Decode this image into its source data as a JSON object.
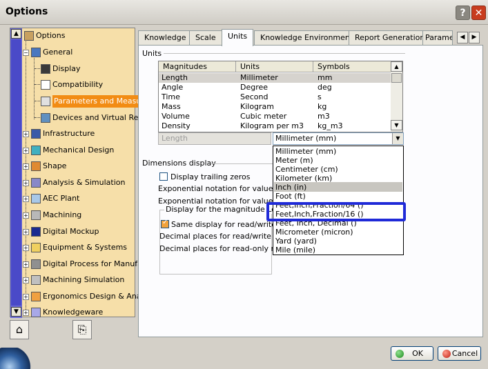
{
  "window": {
    "title": "Options",
    "help_label": "?",
    "close_label": "✕"
  },
  "tree": {
    "scroll_up": "▲",
    "scroll_down": "▼",
    "items": [
      {
        "label": "Options",
        "icon": "options-icon"
      },
      {
        "label": "General",
        "icon": "general-icon"
      },
      {
        "label": "Display",
        "icon": "display-icon"
      },
      {
        "label": "Compatibility",
        "icon": "compatibility-icon"
      },
      {
        "label": "Parameters and Measure",
        "icon": "parameters-icon"
      },
      {
        "label": "Devices and Virtual Realit",
        "icon": "devices-icon"
      },
      {
        "label": "Infrastructure",
        "icon": "infrastructure-icon"
      },
      {
        "label": "Mechanical Design",
        "icon": "mechanical-design-icon"
      },
      {
        "label": "Shape",
        "icon": "shape-icon"
      },
      {
        "label": "Analysis & Simulation",
        "icon": "analysis-icon"
      },
      {
        "label": "AEC Plant",
        "icon": "aec-plant-icon"
      },
      {
        "label": "Machining",
        "icon": "machining-icon"
      },
      {
        "label": "Digital Mockup",
        "icon": "digital-mockup-icon"
      },
      {
        "label": "Equipment & Systems",
        "icon": "equipment-icon"
      },
      {
        "label": "Digital Process for Manufact",
        "icon": "digital-process-icon"
      },
      {
        "label": "Machining Simulation",
        "icon": "machining-simulation-icon"
      },
      {
        "label": "Ergonomics Design & Analys",
        "icon": "ergonomics-icon"
      },
      {
        "label": "Knowledgeware",
        "icon": "knowledgeware-icon"
      }
    ],
    "selected": "Parameters and Measure"
  },
  "tabs": [
    "Knowledge",
    "Scale",
    "Units",
    "Knowledge Environment",
    "Report Generation",
    "Parame"
  ],
  "active_tab": "Units",
  "tab_nav": {
    "prev": "◀",
    "next": "▶"
  },
  "units": {
    "group_label": "Units",
    "columns": [
      "Magnitudes",
      "Units",
      "Symbols"
    ],
    "rows": [
      {
        "magnitude": "Length",
        "unit": "Millimeter",
        "symbol": "mm"
      },
      {
        "magnitude": "Angle",
        "unit": "Degree",
        "symbol": "deg"
      },
      {
        "magnitude": "Time",
        "unit": "Second",
        "symbol": "s"
      },
      {
        "magnitude": "Mass",
        "unit": "Kilogram",
        "symbol": "kg"
      },
      {
        "magnitude": "Volume",
        "unit": "Cubic meter",
        "symbol": "m3"
      },
      {
        "magnitude": "Density",
        "unit": "Kilogram per m3",
        "symbol": "kg_m3"
      }
    ],
    "selected_magnitude_field": "Length",
    "unit_combo_value": "Millimeter (mm)",
    "combo_arrow": "▼",
    "dropdown_options": [
      "Millimeter (mm)",
      "Meter (m)",
      "Centimeter (cm)",
      "Kilometer (km)",
      "Inch (in)",
      "Foot (ft)",
      "Feet,Inch,Fraction/64 ()",
      "Feet,Inch,Fraction/16 ()",
      "Feet, Inch, Decimal ()",
      "Micrometer (micron)",
      "Yard (yard)",
      "Mile (mile)"
    ],
    "highlighted_option": "Inch (in)"
  },
  "dimensions_display": {
    "group_label": "Dimensions display",
    "trailing_zeros_label": "Display trailing zeros",
    "trailing_zeros_checked": false,
    "exp_readwrite_label": "Exponential notation for values g",
    "exp_readonly_label": "Exponential notation for values lo",
    "magnitude_group_label": "Display for the magnitude Length",
    "same_display_label": "Same display for read/write nu",
    "same_display_checked": true,
    "decimal_readwrite_label": "Decimal places for read/write numb",
    "decimal_readonly_label": "Decimal places for read-only numb"
  },
  "buttons": {
    "ok": "OK",
    "cancel": "Cancel"
  },
  "colors": {
    "tree_bg": "#f6dfa9",
    "selected_bg": "#f28c14",
    "highlight_box": "#1f2ad8"
  }
}
